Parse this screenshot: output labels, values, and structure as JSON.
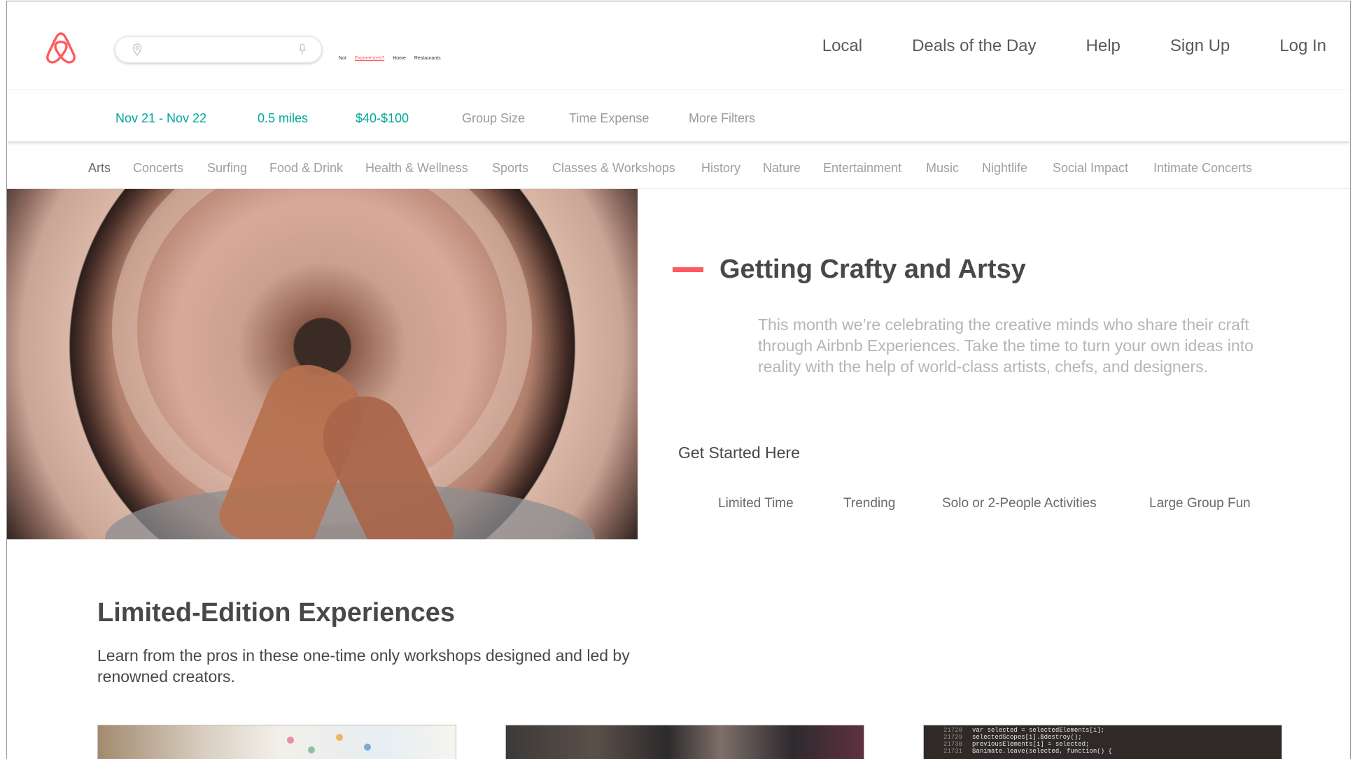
{
  "search": {
    "placeholder": ""
  },
  "mini_links": {
    "not_link": "Not ",
    "experiences": "Experiences?",
    "home": "Home",
    "restaurants": "Restaurants"
  },
  "nav": [
    "Local",
    "Deals of the Day",
    "Help",
    "Sign Up",
    "Log In"
  ],
  "filters": {
    "dates": "Nov 21 - Nov 22",
    "distance": "0.5 miles",
    "price": "$40-$100",
    "group_size": "Group Size",
    "time_expense": "Time Expense",
    "more_filters": "More Filters"
  },
  "categories": [
    "Arts",
    "Concerts",
    "Surfing",
    "Food & Drink",
    "Health & Wellness",
    "Sports",
    "Classes & Workshops",
    "History",
    "Nature",
    "Entertainment",
    "Music",
    "Nightlife",
    "Social Impact",
    "Intimate Concerts"
  ],
  "selected_category": "Arts",
  "hero": {
    "title": "Getting Crafty and Artsy",
    "description": "This month we’re celebrating the creative minds who share their craft through Airbnb Experiences. Take the time to turn your own ideas into reality with the help of world-class artists, chefs, and designers.",
    "get_started": "Get Started Here",
    "links": [
      "Limited Time",
      "Trending",
      "Solo or 2-People Activities",
      "Large Group Fun"
    ]
  },
  "limited_edition": {
    "title": "Limited-Edition Experiences",
    "description": "Learn from the pros in these one-time only workshops designed and led by renowned creators."
  },
  "code_card": {
    "lines": [
      {
        "n": "21728",
        "text": "var selected = selectedElements[i];"
      },
      {
        "n": "21729",
        "text": "selectedScopes[i].$destroy();"
      },
      {
        "n": "21730",
        "text": "previousElements[i] = selected;"
      },
      {
        "n": "21731",
        "text": "$animate.leave(selected, function() {"
      }
    ]
  },
  "colors": {
    "brand": "#ff5a5f",
    "accent_teal": "#00a699",
    "text": "#484848",
    "muted": "#9a9a9a"
  },
  "icons": [
    "airbnb-logo",
    "location-pin-icon",
    "microphone-icon"
  ]
}
